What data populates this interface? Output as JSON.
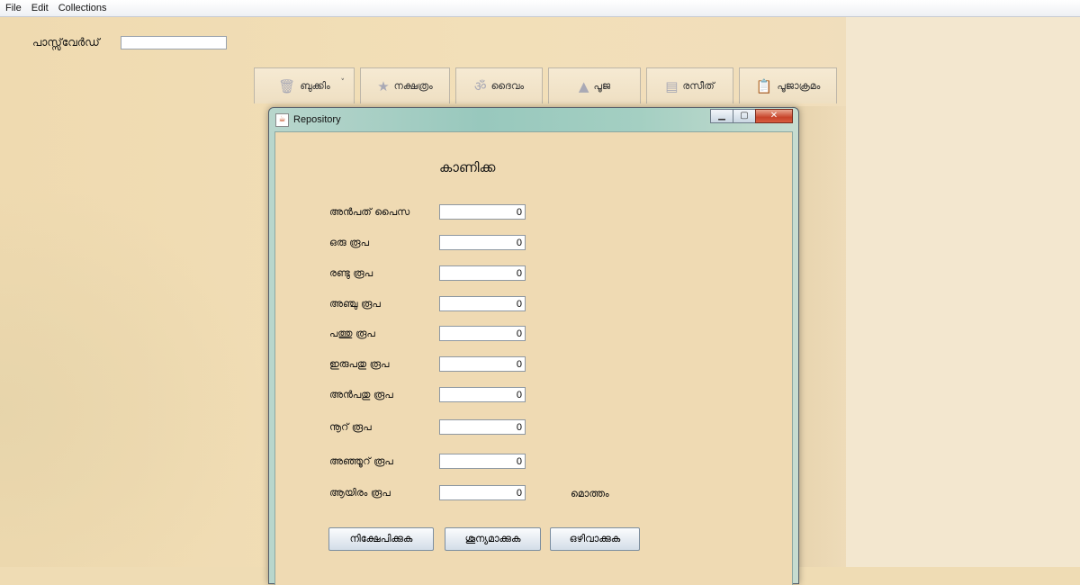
{
  "menu": {
    "items": [
      "File",
      "Edit",
      "Collections"
    ]
  },
  "password": {
    "label": "പാസ്സ്‌വേർഡ്",
    "value": ""
  },
  "tabs": [
    {
      "label": "ബുക്കിം",
      "icon": "trash-icon"
    },
    {
      "label": "നക്ഷത്രം",
      "icon": "star-icon"
    },
    {
      "label": "ദൈവം",
      "icon": "om-icon"
    },
    {
      "label": "പൂജ",
      "icon": "lamp-icon"
    },
    {
      "label": "രസീത്",
      "icon": "receipt-icon"
    },
    {
      "label": "പൂജാക്രമം",
      "icon": "clipboard-icon"
    }
  ],
  "dialog": {
    "window_title": "Repository",
    "heading": "കാണിക്ക",
    "rows": [
      {
        "label": "അൻപത് പൈസ",
        "value": "0"
      },
      {
        "label": "ഒരു രൂപ",
        "value": "0"
      },
      {
        "label": "രണ്ടു രൂപ",
        "value": "0"
      },
      {
        "label": "അഞ്ചു രൂപ",
        "value": "0"
      },
      {
        "label": "പത്തു രൂപ",
        "value": "0"
      },
      {
        "label": "ഇരുപതു രൂപ",
        "value": "0"
      },
      {
        "label": "അൻപതു രൂപ",
        "value": "0"
      },
      {
        "label": "നൂറ് രൂപ",
        "value": "0"
      },
      {
        "label": "അഞ്ഞൂറ് രൂപ",
        "value": "0"
      },
      {
        "label": "ആയിരം രൂപ",
        "value": "0"
      }
    ],
    "total_label": "മൊത്തം",
    "buttons": {
      "deposit": "നിക്ഷേപിക്കുക",
      "clear": "ശൂന്യമാക്കുക",
      "cancel": "ഒഴിവാക്കുക"
    }
  }
}
